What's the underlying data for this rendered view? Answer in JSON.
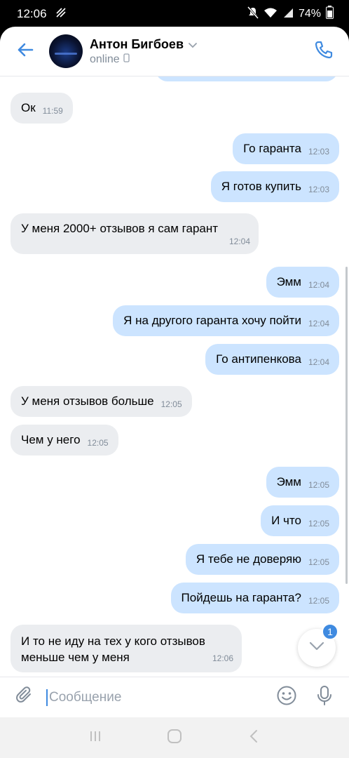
{
  "status_bar": {
    "time": "12:06",
    "battery": "74%"
  },
  "header": {
    "contact_name": "Антон Бигбоев",
    "status": "online",
    "icons": [
      "back-arrow-icon",
      "chevron-down-icon",
      "mobile-phone-icon",
      "phone-call-icon"
    ]
  },
  "colors": {
    "accent": "#3f8ae0",
    "incoming_bubble": "#ebedf0",
    "outgoing_bubble": "#cce4ff",
    "time_text": "#818c99"
  },
  "messages": [
    {
      "dir": "in",
      "text": "Ок",
      "time": "11:59"
    },
    {
      "dir": "out",
      "text": "Го гаранта",
      "time": "12:03"
    },
    {
      "dir": "out",
      "text": "Я готов купить",
      "time": "12:03"
    },
    {
      "dir": "in",
      "text": "У меня 2000+ отзывов я сам гарант",
      "time": "12:04"
    },
    {
      "dir": "out",
      "text": "Эмм",
      "time": "12:04"
    },
    {
      "dir": "out",
      "text": "Я на другого гаранта хочу пойти",
      "time": "12:04"
    },
    {
      "dir": "out",
      "text": "Го антипенкова",
      "time": "12:04"
    },
    {
      "dir": "in",
      "text": "У меня отзывов больше",
      "time": "12:05"
    },
    {
      "dir": "in",
      "text": "Чем у него",
      "time": "12:05"
    },
    {
      "dir": "out",
      "text": "Эмм",
      "time": "12:05"
    },
    {
      "dir": "out",
      "text": "И что",
      "time": "12:05"
    },
    {
      "dir": "out",
      "text": "Я тебе не доверяю",
      "time": "12:05"
    },
    {
      "dir": "out",
      "text": "Пойдешь на гаранта?",
      "time": "12:05"
    },
    {
      "dir": "in",
      "text": "И то не иду на тех у кого отзывов меньше чем у меня",
      "time": "12:06"
    }
  ],
  "scroll_down_badge": "1",
  "composer": {
    "placeholder": "Сообщение",
    "icons": [
      "paperclip-icon",
      "smile-icon",
      "microphone-icon"
    ]
  },
  "nav_bar": {
    "icons": [
      "recents-icon",
      "home-icon",
      "back-icon"
    ]
  }
}
